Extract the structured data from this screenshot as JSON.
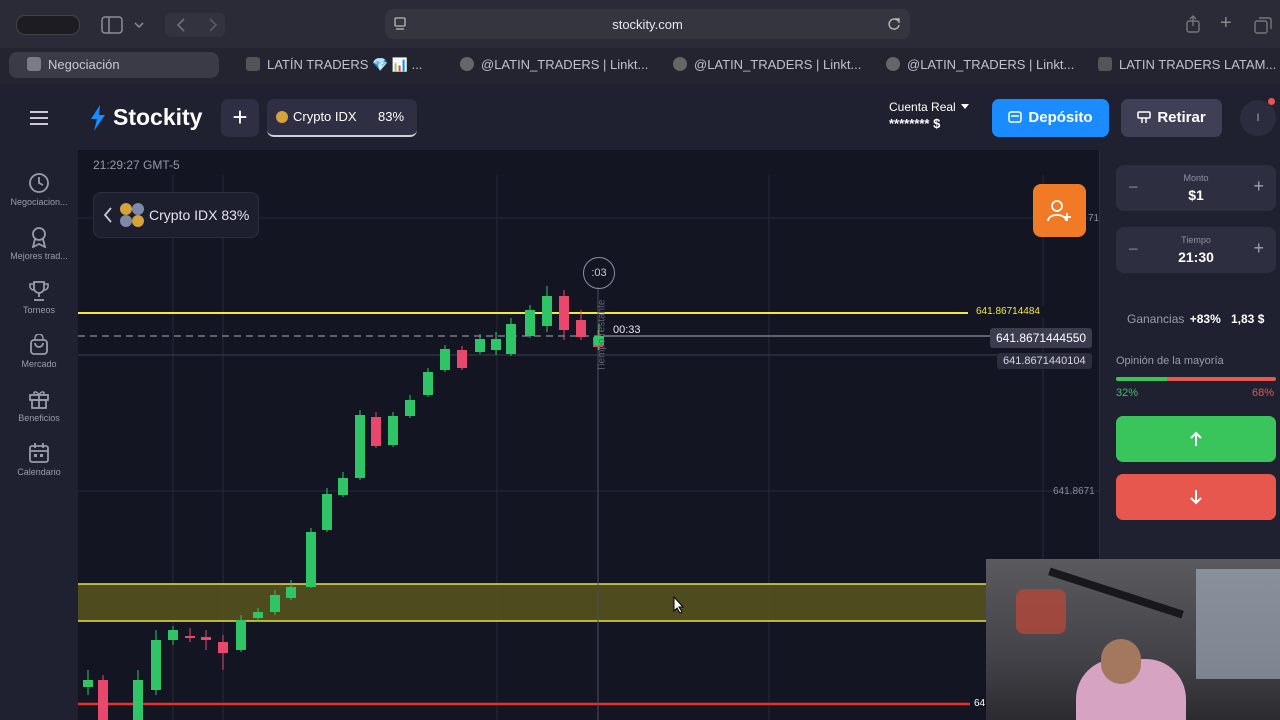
{
  "browser": {
    "url": "stockity.com",
    "tabs": [
      {
        "label": "Negociación",
        "active": true
      },
      {
        "label": "LATÍN TRADERS 💎 📊 ..."
      },
      {
        "label": "@LATIN_TRADERS | Linkt..."
      },
      {
        "label": "@LATIN_TRADERS | Linkt..."
      },
      {
        "label": "@LATIN_TRADERS | Linkt..."
      },
      {
        "label": "LATIN TRADERS LATAM..."
      }
    ]
  },
  "header": {
    "logo": "Stockity",
    "asset": "Crypto IDX",
    "asset_pct": "83%",
    "account_label": "Cuenta Real",
    "balance": "******** $",
    "deposit_label": "Depósito",
    "withdraw_label": "Retirar",
    "avatar_letter": "I"
  },
  "sidebar": {
    "items": [
      {
        "label": "Negociacion...",
        "icon": "clock-icon"
      },
      {
        "label": "Mejores trad...",
        "icon": "award-icon"
      },
      {
        "label": "Torneos",
        "icon": "trophy-icon"
      },
      {
        "label": "Mercado",
        "icon": "bag-icon"
      },
      {
        "label": "Beneficios",
        "icon": "gift-icon"
      },
      {
        "label": "Calendario",
        "icon": "calendar-icon"
      }
    ]
  },
  "chart": {
    "clock": "21:29:27 GMT-5",
    "asset_chip": "Crypto IDX 83%",
    "timer": ":03",
    "countdown": "00:33",
    "vertical_label": "Tiempo restante",
    "prices": {
      "yellow_line": "641.86714484",
      "current": "641.8671444550",
      "open": "641.8671440104",
      "axis_mid": "641.8671",
      "axis_top": "71",
      "axis_bottom": "64"
    }
  },
  "trade": {
    "amount_label": "Monto",
    "amount": "$1",
    "time_label": "Tiempo",
    "time": "21:30",
    "payout_label": "Ganancias",
    "payout_pct": "+83%",
    "payout_value": "1,83 $",
    "sentiment_label": "Opinión de la mayoría",
    "up_pct": "32%",
    "down_pct": "68%",
    "up_fraction": 0.32,
    "colors": {
      "up": "#39c55b",
      "down": "#e8574e",
      "accent": "#1a8cff"
    }
  }
}
